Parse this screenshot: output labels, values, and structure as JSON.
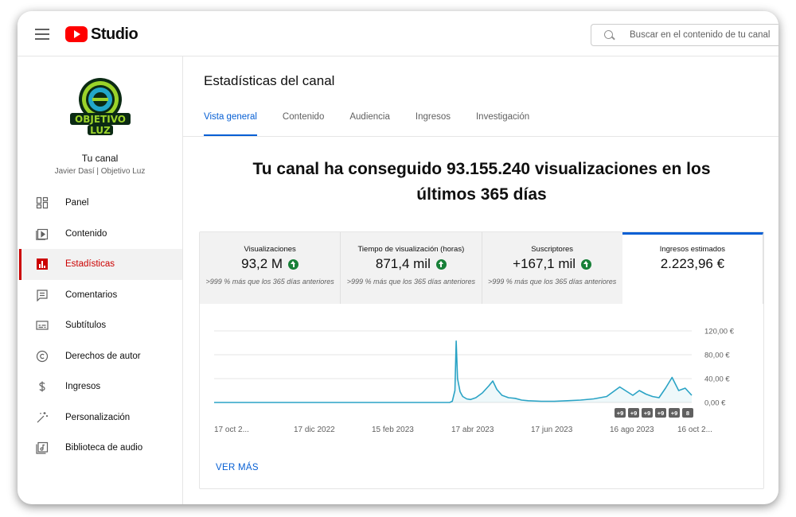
{
  "header": {
    "logo_text": "Studio",
    "search_placeholder": "Buscar en el contenido de tu canal"
  },
  "channel": {
    "avatar_line1": "OBJETIVO",
    "avatar_line2": "LUZ",
    "title": "Tu canal",
    "subtitle": "Javier Dasí | Objetivo Luz"
  },
  "sidebar": {
    "items": [
      {
        "label": "Panel",
        "icon": "dashboard-icon"
      },
      {
        "label": "Contenido",
        "icon": "content-icon"
      },
      {
        "label": "Estadísticas",
        "icon": "analytics-icon",
        "active": true
      },
      {
        "label": "Comentarios",
        "icon": "comments-icon"
      },
      {
        "label": "Subtítulos",
        "icon": "subtitles-icon"
      },
      {
        "label": "Derechos de autor",
        "icon": "copyright-icon"
      },
      {
        "label": "Ingresos",
        "icon": "dollar-icon"
      },
      {
        "label": "Personalización",
        "icon": "magic-wand-icon"
      },
      {
        "label": "Biblioteca de audio",
        "icon": "audio-library-icon"
      }
    ]
  },
  "main": {
    "title": "Estadísticas del canal",
    "tabs": [
      {
        "label": "Vista general",
        "active": true
      },
      {
        "label": "Contenido"
      },
      {
        "label": "Audiencia"
      },
      {
        "label": "Ingresos"
      },
      {
        "label": "Investigación"
      }
    ],
    "headline": "Tu canal ha conseguido 93.155.240 visualizaciones en los últimos 365 días",
    "metrics": [
      {
        "label": "Visualizaciones",
        "value": "93,2 M",
        "trend": "up",
        "comparison": ">999 % más que los 365 días anteriores"
      },
      {
        "label": "Tiempo de visualización (horas)",
        "value": "871,4 mil",
        "trend": "up",
        "comparison": ">999 % más que los 365 días anteriores"
      },
      {
        "label": "Suscriptores",
        "value": "+167,1 mil",
        "trend": "up",
        "comparison": ">999 % más que los 365 días anteriores"
      },
      {
        "label": "Ingresos estimados",
        "value": "2.223,96 €",
        "active": true
      }
    ],
    "see_more": "VER MÁS"
  },
  "chart_data": {
    "type": "line",
    "title": "",
    "xlabel": "",
    "ylabel": "",
    "x_tick_labels": [
      "17 oct 2...",
      "17 dic 2022",
      "15 feb 2023",
      "17 abr 2023",
      "17 jun 2023",
      "16 ago 2023",
      "16 oct 2..."
    ],
    "y_tick_labels": [
      "120,00 €",
      "80,00 €",
      "40,00 €",
      "0,00 €"
    ],
    "ylim": [
      0,
      120
    ],
    "grid": true,
    "series": [
      {
        "color": "#2aa3c5",
        "x": [
          0,
          40,
          80,
          120,
          160,
          180,
          182,
          184,
          185,
          186,
          188,
          190,
          193,
          196,
          200,
          205,
          210,
          213,
          216,
          220,
          225,
          230,
          235,
          240,
          250,
          260,
          270,
          280,
          290,
          300,
          310,
          320,
          325,
          330,
          335,
          340,
          345,
          350,
          355,
          360,
          365
        ],
        "values": [
          0,
          0,
          0,
          0,
          0,
          0,
          2,
          20,
          103,
          40,
          18,
          10,
          6,
          5,
          8,
          16,
          28,
          36,
          22,
          12,
          8,
          7,
          4,
          3,
          2,
          2,
          3,
          4,
          6,
          10,
          26,
          12,
          20,
          14,
          10,
          8,
          24,
          42,
          20,
          24,
          12
        ]
      }
    ],
    "event_markers": [
      "+9",
      "+9",
      "+9",
      "+9",
      "+9",
      "8"
    ]
  }
}
